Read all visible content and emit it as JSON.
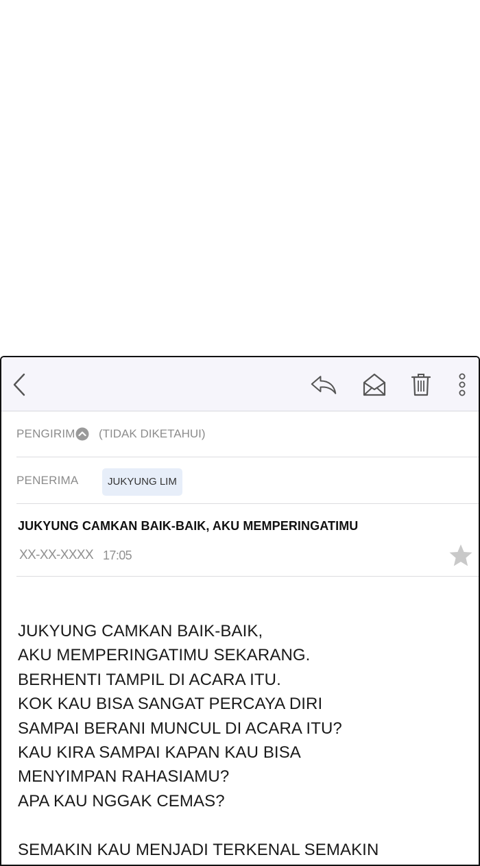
{
  "toolbar": {
    "back_icon": "chevron-left-icon",
    "reply_icon": "reply-icon",
    "mark_unread_icon": "envelope-open-icon",
    "delete_icon": "trash-icon",
    "more_icon": "more-vertical-icon"
  },
  "sender": {
    "label": "PENGIRIM",
    "value": "(TIDAK DIKETAHUI)",
    "toggle_icon": "chevron-up-circle-icon"
  },
  "recipient": {
    "label": "PENERIMA",
    "value": "JUKYUNG LIM"
  },
  "message": {
    "subject": "JUKYUNG CAMKAN BAIK-BAIK, AKU MEMPERINGATIMU",
    "date": "XX-XX-XXXX",
    "time": "17:05",
    "star_icon": "star-icon",
    "body_lines": [
      "JUKYUNG CAMKAN BAIK-BAIK,",
      "AKU MEMPERINGATIMU SEKARANG.",
      "BERHENTI TAMPIL DI ACARA ITU.",
      "KOK KAU BISA SANGAT PERCAYA DIRI",
      "SAMPAI BERANI MUNCUL DI ACARA ITU?",
      "KAU KIRA SAMPAI KAPAN KAU BISA",
      "MENYIMPAN RAHASIAMU?",
      "APA KAU NGGAK CEMAS?",
      "",
      "SEMAKIN KAU MENJADI TERKENAL SEMAKIN"
    ]
  },
  "colors": {
    "toolbar_bg": "#f6f5fb",
    "chip_bg": "#e7eef9",
    "muted_text": "#8c8c8c",
    "body_text": "#1a1a1a"
  }
}
